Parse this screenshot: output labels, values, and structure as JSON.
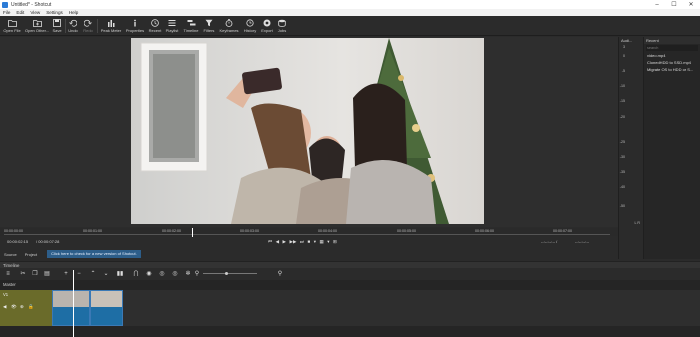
{
  "window": {
    "title": "Untitled* - Shotcut",
    "controls": [
      "–",
      "☐",
      "✕"
    ]
  },
  "menu": [
    "File",
    "Edit",
    "View",
    "Settings",
    "Help"
  ],
  "toolbar": [
    {
      "label": "Open File",
      "icon": "folder-icon",
      "disabled": false
    },
    {
      "label": "Open Other...",
      "icon": "folder-plus-icon",
      "disabled": false
    },
    {
      "label": "Save",
      "icon": "save-icon",
      "disabled": false
    },
    {
      "label": "Undo",
      "icon": "undo-icon",
      "disabled": false
    },
    {
      "label": "Redo",
      "icon": "redo-icon",
      "disabled": true
    },
    {
      "label": "Peak Meter",
      "icon": "peak-meter-icon",
      "disabled": false
    },
    {
      "label": "Properties",
      "icon": "info-icon",
      "disabled": false
    },
    {
      "label": "Recent",
      "icon": "clock-icon",
      "disabled": false
    },
    {
      "label": "Playlist",
      "icon": "list-icon",
      "disabled": false
    },
    {
      "label": "Timeline",
      "icon": "timeline-icon",
      "disabled": false
    },
    {
      "label": "Filters",
      "icon": "filter-icon",
      "disabled": false
    },
    {
      "label": "Keyframes",
      "icon": "stopwatch-icon",
      "disabled": false
    },
    {
      "label": "History",
      "icon": "history-icon",
      "disabled": false
    },
    {
      "label": "Export",
      "icon": "export-icon",
      "disabled": false
    },
    {
      "label": "Jobs",
      "icon": "jobs-icon",
      "disabled": false
    }
  ],
  "audio_panel": {
    "header": "Audi...",
    "ticks": [
      "3",
      "0",
      "-5",
      "-10",
      "-15",
      "-20",
      "-25",
      "-30",
      "-35",
      "-40",
      "-50"
    ],
    "lr": "L  R"
  },
  "recent_panel": {
    "header": "Recent",
    "search_placeholder": "search",
    "items": [
      "video.mp4",
      "ClonedHDD to SSD.mp4",
      "Migrate OS to HDD or S..."
    ]
  },
  "ruler": {
    "labels": [
      "00:00:00:00",
      "00:00:01:00",
      "00:00:02:00",
      "00:00:03:00",
      "00:00:04:00",
      "00:00:05:00",
      "00:00:06:00",
      "00:00:07:00"
    ]
  },
  "transport": {
    "position": "00:00:02:15",
    "duration": "/ 00:00:07:28",
    "in_point": "--:--:--:-- /",
    "out_point": "--:--:--:--",
    "buttons": [
      "⏮",
      "◀",
      "▶",
      "▶▶",
      "⏭",
      "■",
      "▾",
      "▦",
      "▾",
      "⊞"
    ]
  },
  "source_bar": {
    "tabs": [
      "Source",
      "Project"
    ],
    "update_notice": "Click here to check for a new version of Shotcut."
  },
  "timeline": {
    "title": "Timeline",
    "tool_icons": [
      "menu-icon",
      "cut-icon",
      "copy-icon",
      "paste-icon",
      "add-icon",
      "remove-icon",
      "lift-icon",
      "overwrite-icon",
      "split-icon",
      "snap-icon",
      "scrub-icon",
      "ripple-icon",
      "ripple-all-icon",
      "ripple-markers-icon",
      "zoom-out-icon",
      "zoom-in-icon"
    ],
    "master_label": "Master",
    "track_name": "V1",
    "track_icons": [
      "◀",
      "👁",
      "⊕",
      "🔒"
    ]
  }
}
